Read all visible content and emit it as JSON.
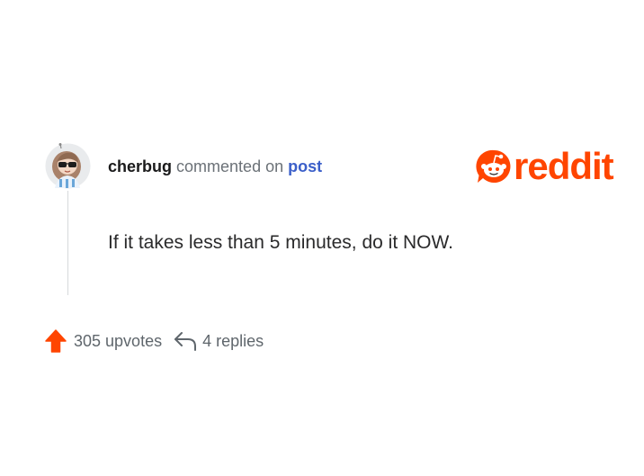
{
  "comment": {
    "username": "cherbug",
    "action_text": "commented on",
    "target_link": "post",
    "body": "If it takes less than 5 minutes, do it NOW."
  },
  "brand": {
    "logo_text": "reddit",
    "logo_icon": "reddit-snoo-icon",
    "accent_color": "#ff4500"
  },
  "stats": {
    "upvotes_label": "305 upvotes",
    "replies_label": "4 replies",
    "upvote_icon": "upvote-arrow-icon",
    "reply_icon": "reply-arrow-icon"
  },
  "avatar": {
    "icon": "user-avatar"
  }
}
